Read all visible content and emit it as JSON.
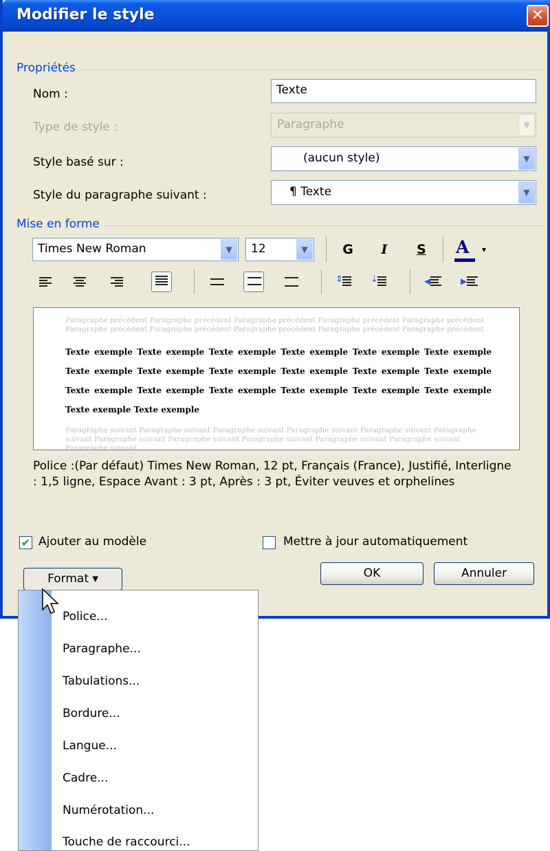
{
  "dialog": {
    "title": "Modifier le style",
    "close_glyph": "✕",
    "properties": {
      "group_label": "Propriétés",
      "name": {
        "label": "Nom :",
        "value": "Texte"
      },
      "style_type": {
        "label": "Type de style :",
        "value": "Paragraphe"
      },
      "based_on": {
        "label": "Style basé sur :",
        "value": "(aucun style)"
      },
      "next_style": {
        "label": "Style du paragraphe suivant :",
        "value": "¶ Texte"
      }
    },
    "formatting": {
      "group_label": "Mise en forme",
      "font": "Times New Roman",
      "size": "12",
      "bold": "G",
      "italic": "I",
      "underline": "S",
      "font_color": "A",
      "font_color_value": "#00008b",
      "dropdown_arrow": "▾",
      "combo_arrow": "▼"
    },
    "preview": {
      "previous_text": "Paragraphe précédent Paragraphe précédent Paragraphe précédent Paragraphe précédent Paragraphe précédent Paragraphe précédent Paragraphe précédent Paragraphe précédent Paragraphe précédent Paragraphe précédent",
      "sample_text": "Texte exemple Texte exemple Texte exemple Texte exemple Texte exemple Texte exemple Texte exemple Texte exemple Texte exemple Texte exemple Texte exemple Texte exemple Texte exemple Texte exemple Texte exemple Texte exemple Texte exemple Texte exemple Texte exemple Texte exemple",
      "next_text": "Paragraphe suivant Paragraphe suivant Paragraphe suivant Paragraphe suivant Paragraphe suivant Paragraphe suivant Paragraphe suivant Paragraphe suivant Paragraphe suivant Paragraphe suivant Paragraphe suivant Paragraphe suivant"
    },
    "description": "Police :(Par défaut) Times New Roman, 12 pt, Français (France), Justifié, Interligne : 1,5 ligne, Espace Avant : 3 pt, Après : 3 pt, Éviter veuves et orphelines",
    "add_to_template": {
      "label": "Ajouter au modèle",
      "checked": true,
      "glyph": "✔"
    },
    "auto_update": {
      "label": "Mettre à jour automatiquement",
      "checked": false
    },
    "buttons": {
      "format": "Format ▾",
      "ok": "OK",
      "cancel": "Annuler"
    }
  },
  "format_menu": {
    "items": [
      "Police...",
      "Paragraphe...",
      "Tabulations...",
      "Bordure...",
      "Langue...",
      "Cadre...",
      "Numérotation...",
      "Touche de raccourci..."
    ]
  }
}
